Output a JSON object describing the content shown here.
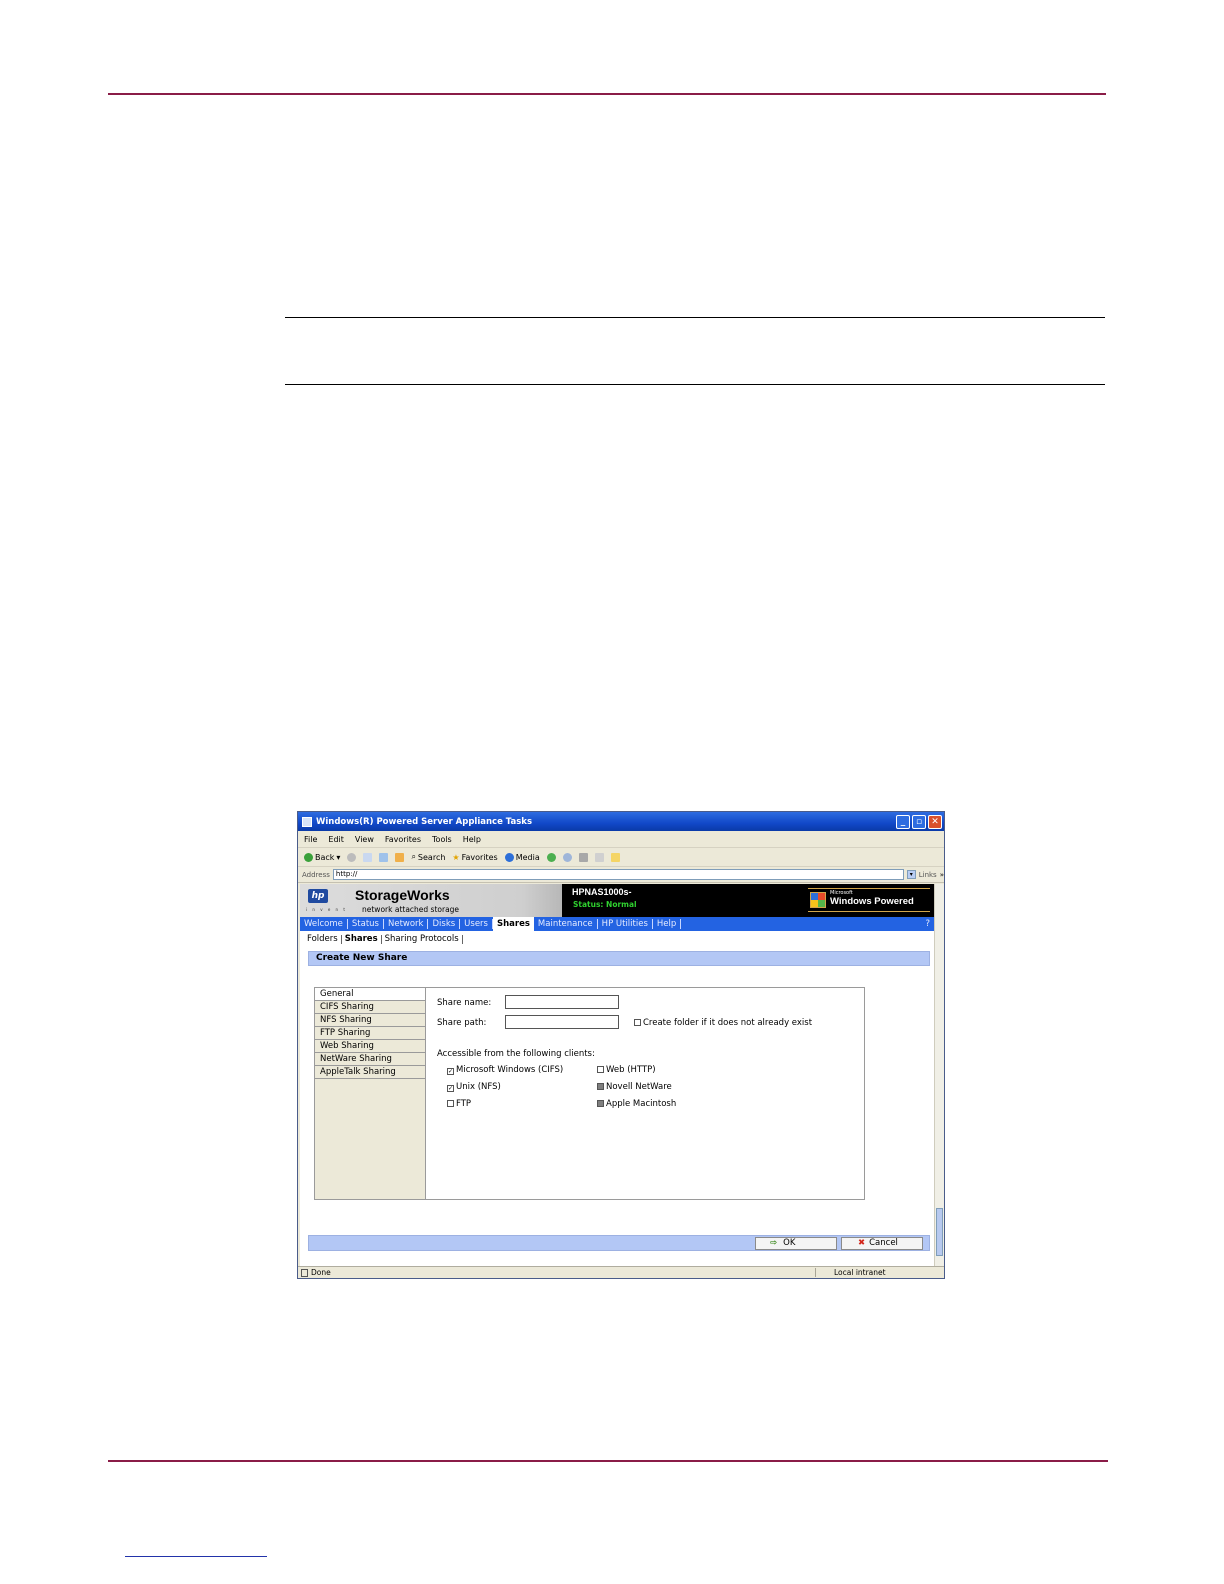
{
  "window": {
    "title": "Windows(R) Powered Server Appliance Tasks",
    "controls": [
      "minimize-icon",
      "maximize-icon",
      "close-icon"
    ]
  },
  "menu": [
    "File",
    "Edit",
    "View",
    "Favorites",
    "Tools",
    "Help"
  ],
  "toolbar": {
    "back": "Back",
    "search": "Search",
    "favorites": "Favorites",
    "media": "Media"
  },
  "address": {
    "label": "Address",
    "value": "http://",
    "links": "Links"
  },
  "banner": {
    "hp_logo": "hp",
    "hp_invent": "i n v e n t",
    "brand": "StorageWorks",
    "brand_sub": "network attached storage",
    "device": "HPNAS1000s-",
    "status": "Status: Normal",
    "win_ms": "Microsoft",
    "win_powered": "Windows Powered"
  },
  "nav": {
    "items": [
      "Welcome",
      "Status",
      "Network",
      "Disks",
      "Users",
      "Shares",
      "Maintenance",
      "HP Utilities",
      "Help"
    ],
    "active": "Shares",
    "help_icon": "?"
  },
  "subnav": [
    "Folders",
    "Shares",
    "Sharing Protocols"
  ],
  "page_title": "Create New Share",
  "tabs": [
    "General",
    "CIFS Sharing",
    "NFS Sharing",
    "FTP Sharing",
    "Web Sharing",
    "NetWare Sharing",
    "AppleTalk Sharing"
  ],
  "form": {
    "share_name_label": "Share name:",
    "share_name_value": "",
    "share_path_label": "Share path:",
    "share_path_value": "",
    "create_folder_label": "Create folder if it does not already exist",
    "create_folder_checked": false,
    "clients_label": "Accessible from the following clients:",
    "clients": [
      {
        "label": "Microsoft Windows (CIFS)",
        "checked": true,
        "disabled": false
      },
      {
        "label": "Web (HTTP)",
        "checked": false,
        "disabled": false
      },
      {
        "label": "Unix (NFS)",
        "checked": true,
        "disabled": false
      },
      {
        "label": "Novell NetWare",
        "checked": false,
        "disabled": true
      },
      {
        "label": "FTP",
        "checked": false,
        "disabled": false
      },
      {
        "label": "Apple Macintosh",
        "checked": false,
        "disabled": true
      }
    ]
  },
  "buttons": {
    "ok": "OK",
    "cancel": "Cancel"
  },
  "statusbar": {
    "left": "Done",
    "zone": "Local intranet"
  },
  "colors": {
    "rule": "#8a1c47",
    "nav": "#2363e2",
    "title_bar": "#b3c7f5",
    "status_ok": "#2fd02f"
  }
}
